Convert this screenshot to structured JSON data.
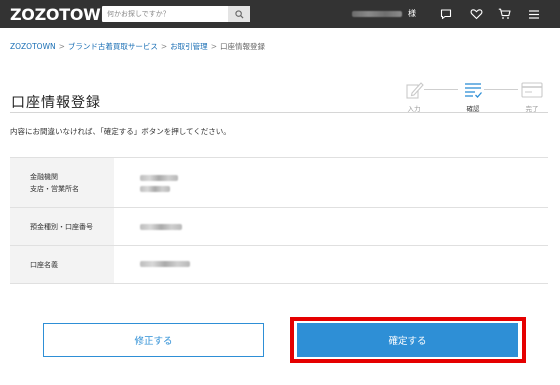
{
  "header": {
    "logo": "ZOZOTOWN",
    "search_placeholder": "何かお探しですか？",
    "user_suffix": "様",
    "icons": [
      "message-icon",
      "heart-icon",
      "cart-icon",
      "menu-icon"
    ]
  },
  "breadcrumb": {
    "items": [
      "ZOZOTOWN",
      "ブランド古着買取サービス",
      "お取引管理"
    ],
    "current": "口座情報登録",
    "separator": ">"
  },
  "page": {
    "title": "口座情報登録",
    "instruction": "内容にお間違いなければ、「確定する」ボタンを押してください。"
  },
  "stepper": {
    "steps": [
      {
        "label": "入力",
        "icon": "pencil-icon",
        "active": false
      },
      {
        "label": "確認",
        "icon": "checklist-icon",
        "active": true
      },
      {
        "label": "完了",
        "icon": "card-icon",
        "active": false
      }
    ]
  },
  "table": {
    "rows": [
      {
        "label_lines": [
          "金融機関",
          "支店・営業所名"
        ]
      },
      {
        "label_lines": [
          "預金種別・口座番号"
        ]
      },
      {
        "label_lines": [
          "口座名義"
        ]
      }
    ]
  },
  "buttons": {
    "edit": "修正する",
    "confirm": "確定する"
  },
  "colors": {
    "accent": "#2e8fd6",
    "header_bg": "#333333",
    "highlight": "#e50000",
    "link": "#1a6fb5"
  }
}
